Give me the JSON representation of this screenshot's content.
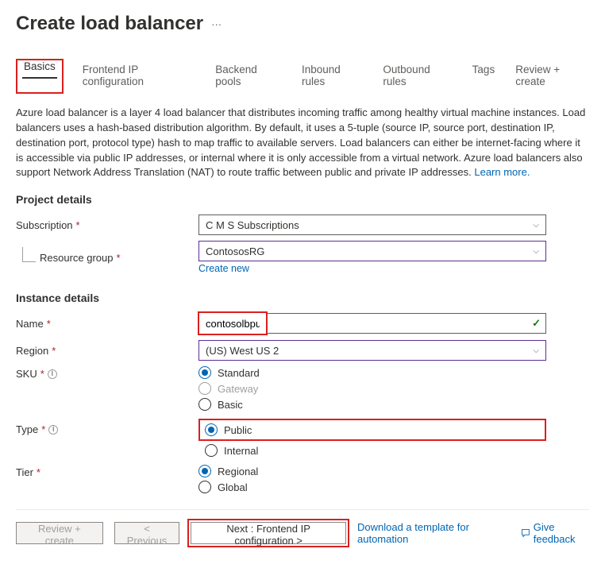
{
  "header": {
    "title": "Create load balancer"
  },
  "tabs": {
    "basics": "Basics",
    "frontend": "Frontend IP configuration",
    "backend": "Backend pools",
    "inbound": "Inbound rules",
    "outbound": "Outbound rules",
    "tags": "Tags",
    "review": "Review + create"
  },
  "description": {
    "text": "Azure load balancer is a layer 4 load balancer that distributes incoming traffic among healthy virtual machine instances. Load balancers uses a hash-based distribution algorithm. By default, it uses a 5-tuple (source IP, source port, destination IP, destination port, protocol type) hash to map traffic to available servers. Load balancers can either be internet-facing where it is accessible via public IP addresses, or internal where it is only accessible from a virtual network. Azure load balancers also support Network Address Translation (NAT) to route traffic between public and private IP addresses.  ",
    "learn_more": "Learn more."
  },
  "project": {
    "heading": "Project details",
    "subscription_label": "Subscription",
    "subscription_value": "C M S Subscriptions",
    "rg_label": "Resource group",
    "rg_value": "ContososRG",
    "create_new": "Create new"
  },
  "instance": {
    "heading": "Instance details",
    "name_label": "Name",
    "name_value": "contosolbpub",
    "region_label": "Region",
    "region_value": "(US) West US 2",
    "sku_label": "SKU",
    "sku_standard": "Standard",
    "sku_gateway": "Gateway",
    "sku_basic": "Basic",
    "type_label": "Type",
    "type_public": "Public",
    "type_internal": "Internal",
    "tier_label": "Tier",
    "tier_regional": "Regional",
    "tier_global": "Global"
  },
  "footer": {
    "review": "Review + create",
    "prev": "< Previous",
    "next": "Next : Frontend IP configuration >",
    "download": "Download a template for automation",
    "feedback": "Give feedback"
  }
}
